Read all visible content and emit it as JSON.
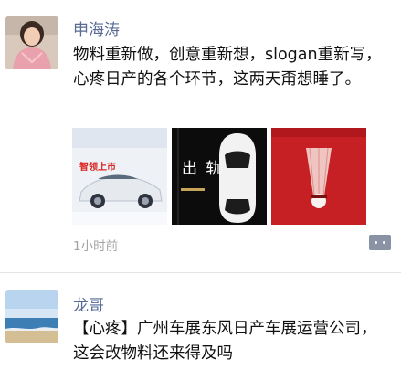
{
  "posts": [
    {
      "author": "申海涛",
      "text": "物料重新做，创意重新想，slogan重新写，心疼日产的各个环节，这两天甭想睡了。",
      "images": [
        {
          "label": "智领上市"
        },
        {
          "label": "出 轨"
        },
        {
          "label": ""
        }
      ],
      "timestamp": "1小时前"
    },
    {
      "author": "龙哥",
      "text": "【心疼】广州车展东风日产车展运营公司，这会改物料还来得及吗"
    }
  ],
  "icons": {
    "comment": "comment-more-icon"
  },
  "colors": {
    "author_name": "#576b95",
    "timestamp": "#a2a2a2",
    "comment_button": "#8a92a5"
  }
}
